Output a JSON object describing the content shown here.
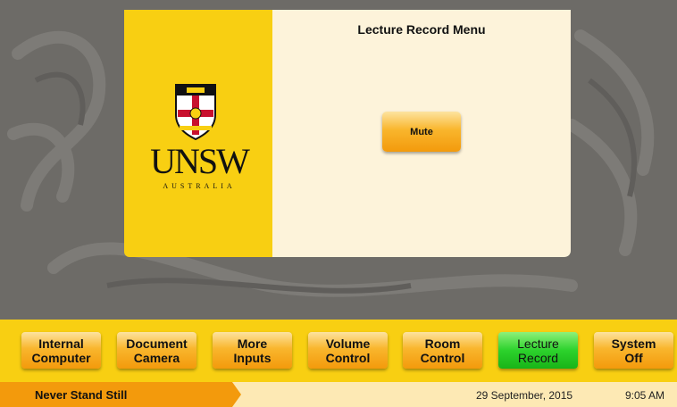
{
  "screen": {
    "menu_title": "Lecture Record Menu",
    "mute_label": "Mute"
  },
  "logo": {
    "wordmark": "UNSW",
    "subtitle": "AUSTRALIA",
    "crest_motto": "MANU ET MENTE"
  },
  "nav": {
    "buttons": [
      {
        "line1": "Internal",
        "line2": "Computer",
        "active": false
      },
      {
        "line1": "Document",
        "line2": "Camera",
        "active": false
      },
      {
        "line1": "More",
        "line2": "Inputs",
        "active": false
      },
      {
        "line1": "Volume",
        "line2": "Control",
        "active": false
      },
      {
        "line1": "Room",
        "line2": "Control",
        "active": false
      },
      {
        "line1": "Lecture",
        "line2": "Record",
        "active": true
      },
      {
        "line1": "System",
        "line2": "Off",
        "active": false
      }
    ]
  },
  "status": {
    "tagline": "Never Stand Still",
    "date": "29 September, 2015",
    "time": "9:05 AM"
  },
  "colors": {
    "brand_yellow": "#f8cf12",
    "button_orange": "#f9b62d",
    "active_green": "#2cd22c",
    "panel_cream": "#fdf3da",
    "background_grey": "#6d6b67"
  }
}
